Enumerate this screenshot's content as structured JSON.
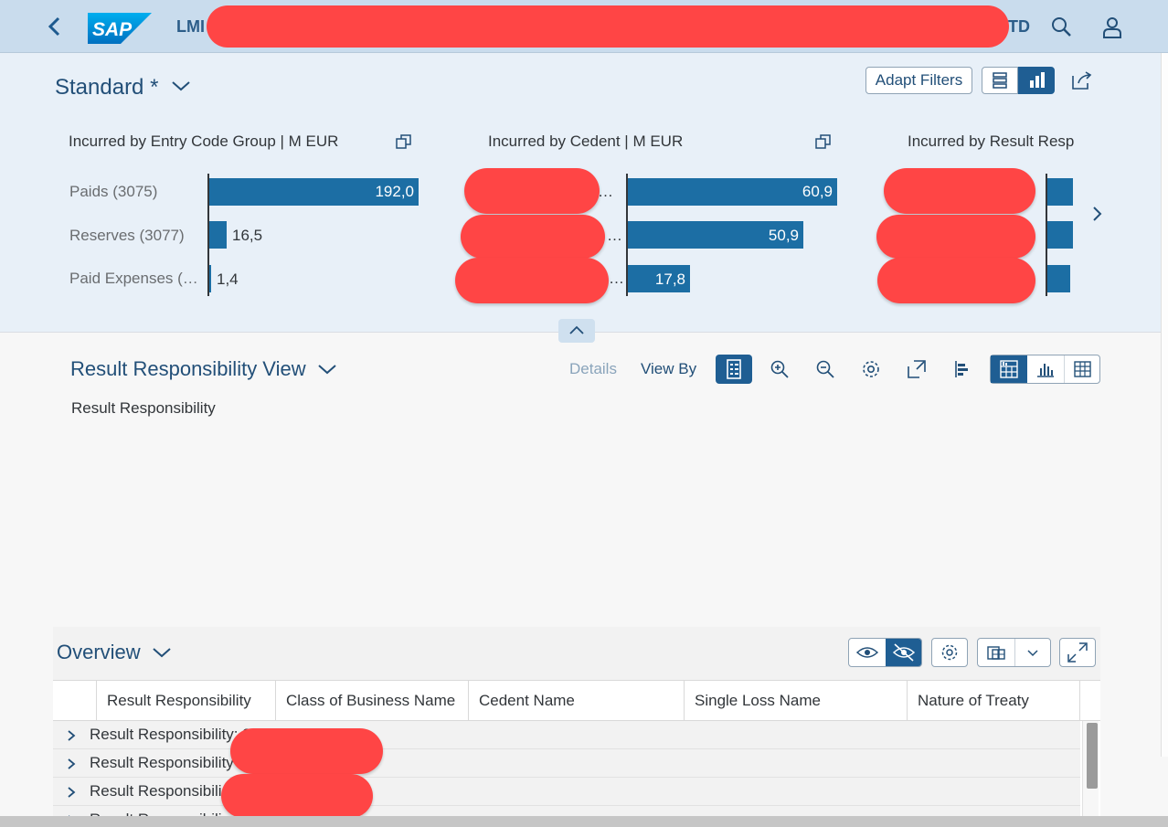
{
  "shell": {
    "title_start": "LMI",
    "title_end": "TD",
    "logo_text": "SAP"
  },
  "header": {
    "variant": "Standard *",
    "adapt_filters": "Adapt Filters"
  },
  "charts": [
    {
      "title": "Incurred by Entry Code Group  | M EUR",
      "categories": [
        "Paids (3075)",
        "Reserves (3077)",
        "Paid Expenses (…"
      ],
      "labels": [
        "192,0",
        "16,5",
        "1,4"
      ]
    },
    {
      "title": "Incurred by Cedent  | M EUR",
      "ellipsis": [
        "…",
        "…",
        "…"
      ],
      "labels": [
        "60,9",
        "50,9",
        "17,8"
      ]
    },
    {
      "title": "Incurred by Result Resp"
    }
  ],
  "chart_data": [
    {
      "type": "bar",
      "title": "Incurred by Entry Code Group  | M EUR",
      "categories": [
        "Paids (3075)",
        "Reserves (3077)",
        "Paid Expenses (…"
      ],
      "values": [
        192.0,
        16.5,
        1.4
      ]
    },
    {
      "type": "bar",
      "title": "Incurred by Cedent  | M EUR",
      "values": [
        60.9,
        50.9,
        17.8
      ]
    }
  ],
  "view": {
    "title": "Result Responsibility View",
    "details": "Details",
    "view_by": "View By",
    "dimension": "Result Responsibility"
  },
  "overview": {
    "title": "Overview",
    "columns": [
      "Result Responsibility",
      "Class of Business Name",
      "Cedent Name",
      "Single Loss Name",
      "Nature of Treaty"
    ],
    "rows": [
      "Result Responsibility: 3073 - OSNA…",
      "Result Responsibility",
      "Result Responsibili",
      "Result Responsibili"
    ]
  },
  "colors": {
    "shell_bg": "#c9dced",
    "bar": "#1c6ea4",
    "accent": "#1f5e93"
  }
}
